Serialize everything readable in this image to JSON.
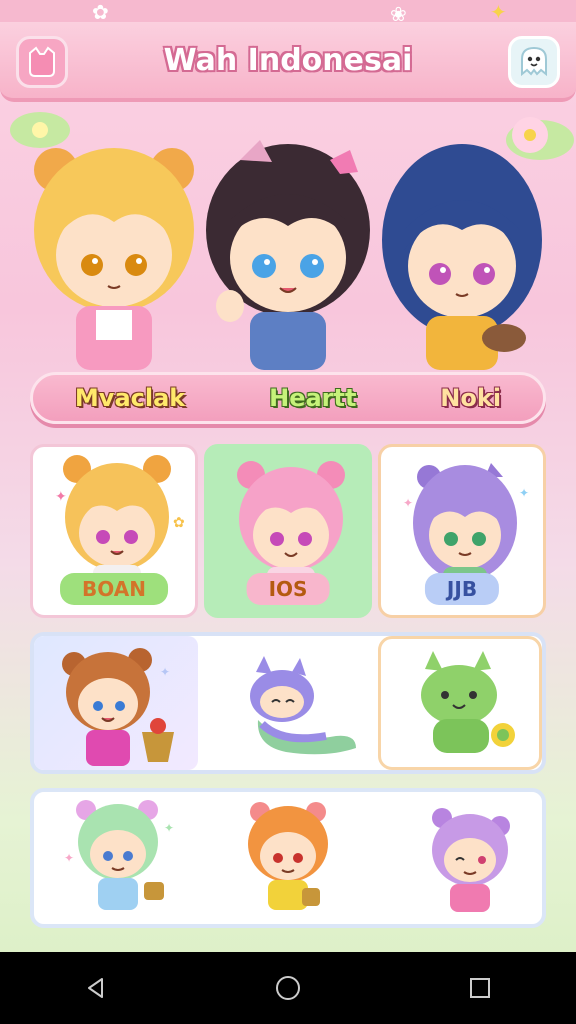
{
  "header": {
    "title": "Wah Indonesai",
    "left_icon": "cat-sticker-icon",
    "right_icon": "ghost-icon"
  },
  "hero": {
    "characters": [
      {
        "name": "Mvaclak",
        "hair": "#f7c85a",
        "eyes": "#d98a10",
        "outfit": "#f79ac0"
      },
      {
        "name": "Heartt",
        "hair": "#3b2a33",
        "eyes": "#4aa3e6",
        "outfit": "#5d7fc4"
      },
      {
        "name": "Noki",
        "hair": "#2f4b92",
        "eyes": "#c053b8",
        "outfit": "#f2b53c"
      }
    ]
  },
  "grid": {
    "row1": [
      {
        "label": "BOAN",
        "hair": "#f6c25a",
        "eyes": "#c64ab8",
        "bg": "white"
      },
      {
        "label": "IOS",
        "hair": "#f6a2c8",
        "eyes": "#c64ab8",
        "bg": "green"
      },
      {
        "label": "JJB",
        "hair": "#a88ce0",
        "eyes": "#3fa36a",
        "bg": "white"
      }
    ],
    "row2": [
      {
        "label": "",
        "hair": "#c7733a",
        "eyes": "#3a7bd5",
        "kind": "girl"
      },
      {
        "label": "",
        "hair": "#9a8ce6",
        "eyes": "#333",
        "kind": "slug"
      },
      {
        "label": "",
        "hair": "#8fd16a",
        "eyes": "#333",
        "kind": "cat"
      }
    ],
    "row3": [
      {
        "label": "",
        "hair": "#a9e3b0",
        "eyes": "#4a7bd0"
      },
      {
        "label": "",
        "hair": "#f29440",
        "eyes": "#c8322d"
      },
      {
        "label": "",
        "hair": "#c79ae6",
        "eyes": "#d04070"
      }
    ]
  },
  "navbar": {
    "back_icon": "back-triangle-icon",
    "home_icon": "home-circle-icon",
    "recents_icon": "recents-square-icon"
  }
}
